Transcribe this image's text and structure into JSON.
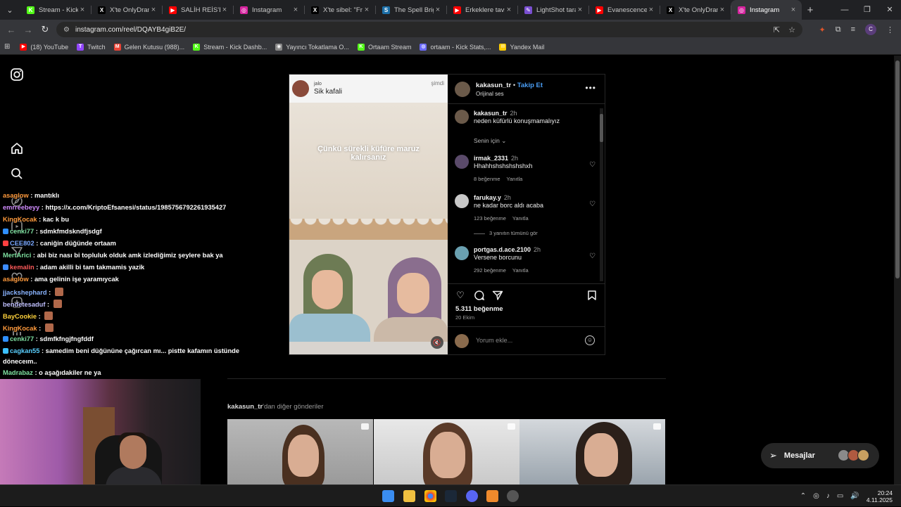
{
  "browser": {
    "tabs": [
      {
        "label": "Stream - Kick D",
        "icon": "kick-icon",
        "color": "#53fc18",
        "glyph": "K",
        "active": false
      },
      {
        "label": "X'te OnlyDram",
        "icon": "x-icon",
        "color": "#000000",
        "glyph": "X",
        "active": false
      },
      {
        "label": "SALİH REİS'E N",
        "icon": "youtube-icon",
        "color": "#ff0000",
        "glyph": "▶",
        "active": false
      },
      {
        "label": "Instagram",
        "icon": "instagram-icon",
        "color": "#d6249f",
        "glyph": "◎",
        "active": false
      },
      {
        "label": "X'te sibel: \"Fra",
        "icon": "x-icon",
        "color": "#000000",
        "glyph": "X",
        "active": false
      },
      {
        "label": "The Spell Briga",
        "icon": "steam-icon",
        "color": "#1b6fa8",
        "glyph": "S",
        "active": false
      },
      {
        "label": "Erkeklere tavsi",
        "icon": "youtube-icon",
        "color": "#ff0000",
        "glyph": "▶",
        "active": false
      },
      {
        "label": "LightShot tarafı",
        "icon": "lightshot-icon",
        "color": "#7a4fd1",
        "glyph": "✎",
        "active": false
      },
      {
        "label": "Evanescence -",
        "icon": "youtube-icon",
        "color": "#ff0000",
        "glyph": "▶",
        "active": false
      },
      {
        "label": "X'te OnlyDram",
        "icon": "x-icon",
        "color": "#000000",
        "glyph": "X",
        "active": false
      },
      {
        "label": "Instagram",
        "icon": "instagram-icon",
        "color": "#d6249f",
        "glyph": "◎",
        "active": true
      }
    ],
    "url": "instagram.com/reel/DQAYB4giB2E/",
    "bookmarks": [
      {
        "label": "(18) YouTube",
        "color": "#ff0000",
        "glyph": "▶"
      },
      {
        "label": "Twitch",
        "color": "#9146ff",
        "glyph": "T"
      },
      {
        "label": "Gelen Kutusu (988)...",
        "color": "#ea4335",
        "glyph": "M"
      },
      {
        "label": "Stream - Kick Dashb...",
        "color": "#53fc18",
        "glyph": "K"
      },
      {
        "label": "Yayıncı Tokatlama O...",
        "color": "#888888",
        "glyph": "◉"
      },
      {
        "label": "Ortaam Stream",
        "color": "#53fc18",
        "glyph": "K"
      },
      {
        "label": "ortaam - Kick Stats,...",
        "color": "#6a6aff",
        "glyph": "◍"
      },
      {
        "label": "Yandex Mail",
        "color": "#ffcc00",
        "glyph": "✉"
      }
    ],
    "profile_initial": "C"
  },
  "post": {
    "media_top": {
      "name": "jalo",
      "caption": "Sik kafali",
      "time": "şimdi"
    },
    "overlay_text": "Çünkü sürekli küfüre maruz kalırsanız",
    "author": "kakasun_tr",
    "follow_label": "Takip Et",
    "audio": "Orijinal ses",
    "caption_user": "kakasun_tr",
    "caption_time": "2h",
    "caption_text": "neden küfürlü konuşmamalıyız",
    "sort_label": "Senin için",
    "comments": [
      {
        "user": "irmak_2331",
        "time": "2h",
        "text": "Hhahhshshshshshxh",
        "likes": "8 beğenme",
        "reply": "Yanıtla",
        "avatar": "#5a4a6a"
      },
      {
        "user": "farukay.y",
        "time": "2h",
        "text": "ne kadar borc aldı acaba",
        "likes": "123 beğenme",
        "reply": "Yanıtla",
        "avatar": "#c8c8c8"
      },
      {
        "user": "portgas.d.ace.2100",
        "time": "2h",
        "text": "Versene borcunu",
        "likes": "292 beğenme",
        "reply": "Yanıtla",
        "avatar": "#6aa0b0"
      }
    ],
    "view_replies": "3 yanıtın tümünü gör",
    "like_count": "5.311 beğenme",
    "date": "20 Ekim",
    "add_comment_placeholder": "Yorum ekle..."
  },
  "more_posts": {
    "owner": "kakasun_tr",
    "suffix": "'dan diğer gönderiler"
  },
  "messages_label": "Mesajlar",
  "chat": [
    {
      "user": "asaglow",
      "text": "mantıklı",
      "color": "#ff9a3c"
    },
    {
      "user": "emrreebeyy",
      "text": "https://x.com/KriptoEfsanesi/status/1985756792261935427",
      "color": "#d18cff"
    },
    {
      "user": "KingKocak",
      "text": "kac k bu",
      "color": "#ff9a3c"
    },
    {
      "user": "cenki77",
      "text": "sdmkfmdskndfjsdgf",
      "color": "#7ee0a0"
    },
    {
      "user": "CEE802",
      "text": "caniğin düğünde ortaam",
      "color": "#7aa8ff"
    },
    {
      "user": "MertArici",
      "text": "abi biz nası bi topluluk olduk amk izlediğimiz şeylere bak ya",
      "color": "#7ee0a0"
    },
    {
      "user": "kemalin",
      "text": "adam akilli bi tam takmamis yazik",
      "color": "#ff5a5a"
    },
    {
      "user": "asaglow",
      "text": "ama gelinin işe yaramıycak",
      "color": "#ff9a3c"
    },
    {
      "user": "jjackshephard",
      "text": "",
      "color": "#8ab4ff"
    },
    {
      "user": "bendetesaduf",
      "text": "",
      "color": "#c0c0ff"
    },
    {
      "user": "BayCookie",
      "text": "",
      "color": "#ffd23c"
    },
    {
      "user": "KingKocak",
      "text": "",
      "color": "#ff9a3c"
    },
    {
      "user": "cenki77",
      "text": "sdmfkfngjfngfddf",
      "color": "#7ee0a0"
    },
    {
      "user": "cagkan55",
      "text": "samedim beni düğününe çağırcan mı... pistte kafamın üstünde",
      "color": "#5ad0ff"
    },
    {
      "user": "",
      "text": "döneceım..",
      "color": "#ffffff"
    },
    {
      "user": "Madrabaz",
      "text": "o aşağıdakiler ne ya",
      "color": "#7ee0a0"
    }
  ],
  "taskbar": {
    "time": "20:24",
    "date": "4.11.2025"
  },
  "colors": {
    "accent": "#4a9ef5",
    "bg": "#000000",
    "border": "#262626"
  }
}
